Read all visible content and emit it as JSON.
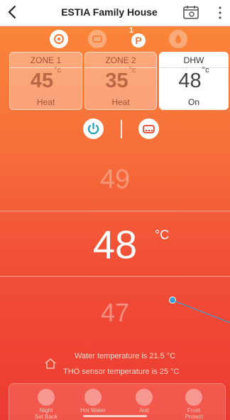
{
  "header": {
    "title": "ESTIA Family House",
    "back_icon": "back-chevron-icon",
    "calendar_icon": "calendar-icon",
    "menu_icon": "kebab-menu-icon"
  },
  "mode_icons": [
    {
      "name": "heat-pump-icon",
      "active": true
    },
    {
      "name": "cooling-icon",
      "active": false
    },
    {
      "name": "schedule-p-icon",
      "active": true,
      "badge": "1"
    },
    {
      "name": "water-drop-icon",
      "active": false
    }
  ],
  "zones": [
    {
      "name": "ZONE 1",
      "temp": "45",
      "unit": "°c",
      "status": "Heat",
      "selected": false
    },
    {
      "name": "ZONE 2",
      "temp": "35",
      "unit": "°c",
      "status": "Heat",
      "selected": false
    },
    {
      "name": "DHW",
      "temp": "48",
      "unit": "°c",
      "status": "On",
      "selected": true
    }
  ],
  "controls": {
    "power_icon": "power-icon",
    "mode_icon": "heating-mode-icon"
  },
  "temperature": {
    "above": "49",
    "current": "48",
    "unit": "°C",
    "below": "47"
  },
  "info": {
    "water_temperature": "Water temperature is 21.5 °C",
    "tho_temperature": "THO sensor temperature is 25 °C"
  },
  "bottom_menu": [
    {
      "label": "Night\nSet Back",
      "icon": "moon-icon"
    },
    {
      "label": "Hot Water",
      "icon": "hot-water-icon"
    },
    {
      "label": "Anti",
      "icon": "anti-bacteria-icon"
    },
    {
      "label": "Frost\nProtect",
      "icon": "frost-icon"
    }
  ],
  "colors": {
    "background_top": "#fb8a3a",
    "background_bottom": "#ec3a33",
    "accent_blue": "#3aa0d8"
  }
}
